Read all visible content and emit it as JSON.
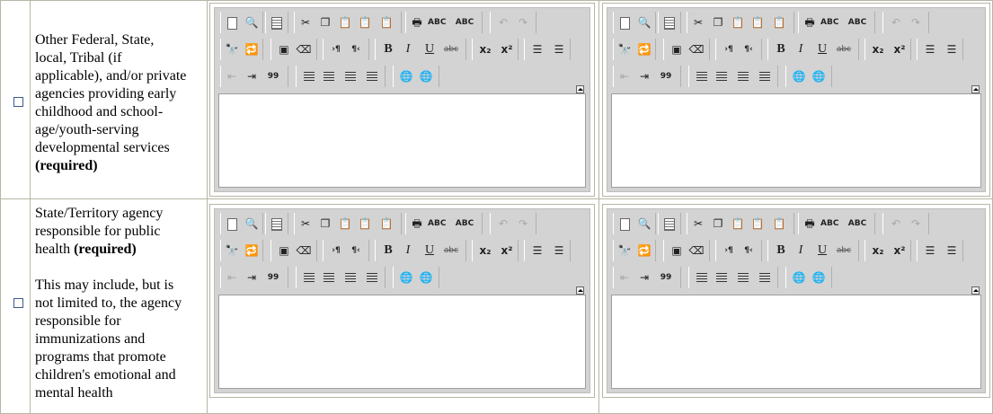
{
  "rows": [
    {
      "label_lines": [
        "Other Federal, State,",
        "local, Tribal (if",
        "applicable), and/or private",
        "agencies providing early",
        "childhood and school-",
        "age/youth-serving",
        "developmental services"
      ],
      "required": "(required)",
      "extra_lines": []
    },
    {
      "label_lines": [
        "State/Territory agency",
        "responsible for public"
      ],
      "required_inline_prefix": "health",
      "required": "(required)",
      "extra_lines": [
        "This may include, but is",
        "not limited to, the agency",
        "responsible for",
        "immunizations and",
        "programs that promote",
        "children's emotional and",
        "mental health"
      ]
    }
  ],
  "toolbar": {
    "row1": [
      "new-page-icon",
      "preview-icon",
      "templates-icon",
      "cut-icon",
      "copy-icon",
      "paste-icon",
      "paste-text-icon",
      "paste-word-icon",
      "print-icon",
      "spellcheck-icon",
      "spellcheck-as-you-type-icon",
      "undo-icon",
      "redo-icon"
    ],
    "row2": [
      "find-icon",
      "replace-icon",
      "select-all-icon",
      "remove-format-icon",
      "ltr-icon",
      "rtl-icon",
      "bold-icon",
      "italic-icon",
      "underline-icon",
      "strike-icon",
      "subscript-icon",
      "superscript-icon",
      "numbered-list-icon",
      "bulleted-list-icon"
    ],
    "row3": [
      "outdent-icon",
      "indent-icon",
      "blockquote-icon",
      "align-left-icon",
      "align-center-icon",
      "align-right-icon",
      "justify-icon",
      "link-icon",
      "unlink-icon"
    ],
    "glyphs": {
      "bold": "B",
      "italic": "I",
      "underline": "U",
      "strike": "abc",
      "subscript": "x₂",
      "superscript": "x²",
      "spell": "ABC",
      "quote": "99",
      "ltr": "›¶",
      "rtl": "¶‹",
      "undo": "↶",
      "redo": "↷"
    }
  },
  "colors": {
    "toolbar_bg": "#d3d3d3",
    "border": "#b8b6a4",
    "checkbox": "#3a5a8c"
  }
}
